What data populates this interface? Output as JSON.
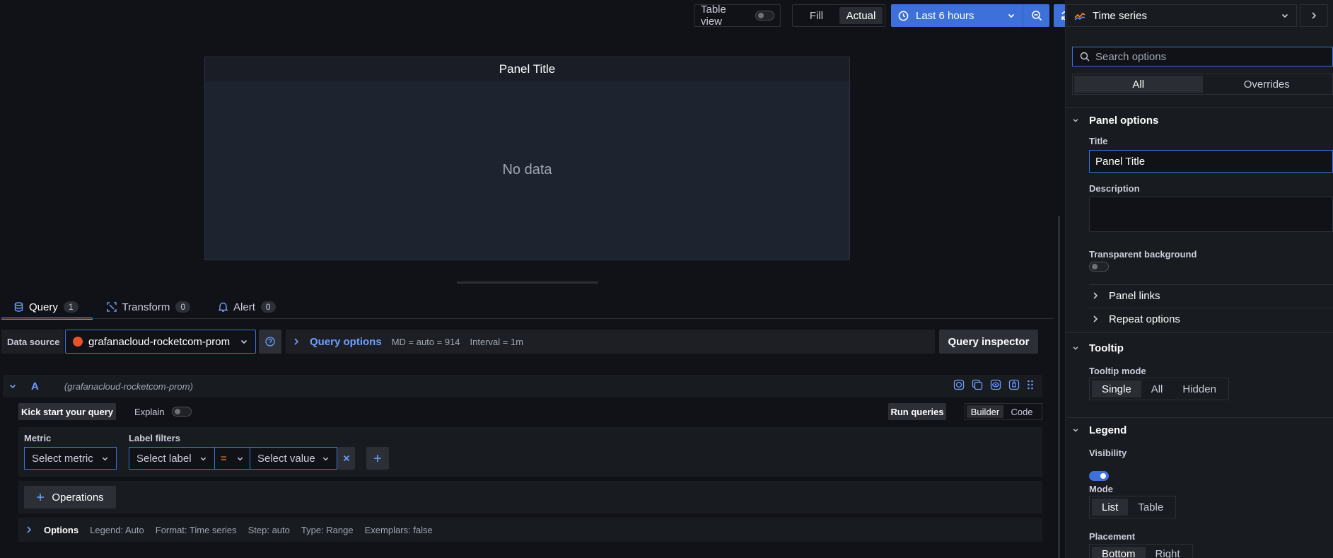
{
  "toolbar": {
    "table_view_label": "Table view",
    "fill_label": "Fill",
    "actual_label": "Actual",
    "time_range": "Last 6 hours"
  },
  "panel": {
    "title": "Panel Title",
    "no_data": "No data"
  },
  "tabs": [
    {
      "label": "Query",
      "count": "1"
    },
    {
      "label": "Transform",
      "count": "0"
    },
    {
      "label": "Alert",
      "count": "0"
    }
  ],
  "datasource": {
    "label": "Data source",
    "name": "grafanacloud-rocketcom-prom",
    "query_options": "Query options",
    "md": "MD = auto = 914",
    "interval": "Interval = 1m",
    "query_inspector": "Query inspector"
  },
  "query": {
    "ref_id": "A",
    "ds_name": "(grafanacloud-rocketcom-prom)",
    "kick_start": "Kick start your query",
    "explain": "Explain",
    "run_queries": "Run queries",
    "builder": "Builder",
    "code": "Code",
    "metric_label": "Metric",
    "metric_placeholder": "Select metric",
    "label_filters": "Label filters",
    "select_label": "Select label",
    "operator": "=",
    "select_value": "Select value",
    "operations": "Operations",
    "options": {
      "label": "Options",
      "legend": "Legend: Auto",
      "format": "Format: Time series",
      "step": "Step: auto",
      "type": "Type: Range",
      "exemplars": "Exemplars: false"
    }
  },
  "options_pane": {
    "viz": "Time series",
    "search_placeholder": "Search options",
    "all": "All",
    "overrides": "Overrides",
    "panel_options": "Panel options",
    "title_label": "Title",
    "title_value": "Panel Title",
    "description_label": "Description",
    "transparent_label": "Transparent background",
    "panel_links": "Panel links",
    "repeat_options": "Repeat options",
    "tooltip": "Tooltip",
    "tooltip_mode_label": "Tooltip mode",
    "tooltip_modes": [
      "Single",
      "All",
      "Hidden"
    ],
    "legend": "Legend",
    "visibility_label": "Visibility",
    "mode_label": "Mode",
    "modes": [
      "List",
      "Table"
    ],
    "placement_label": "Placement",
    "placements": [
      "Bottom",
      "Right"
    ]
  },
  "colors": {
    "primary": "#3d71d9",
    "background": "#111217",
    "panel_bg": "#1e2330",
    "tab_accent": "#f55f3e"
  }
}
